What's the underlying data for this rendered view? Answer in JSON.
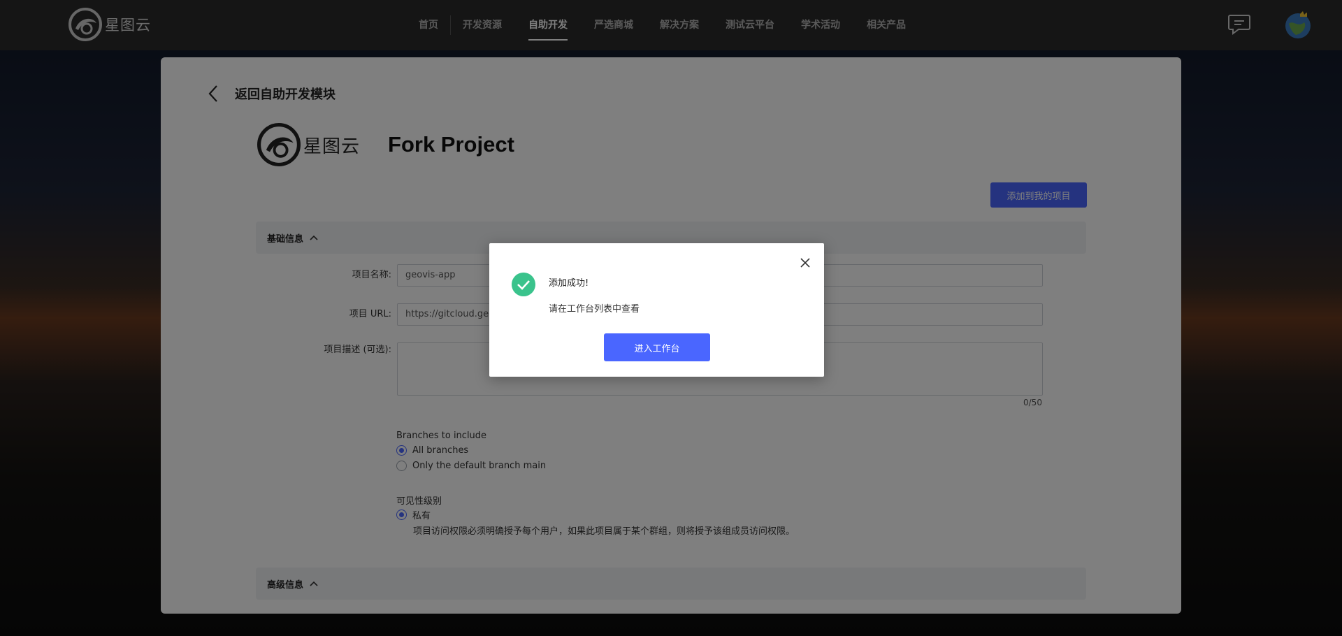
{
  "header": {
    "logo_text": "星图云",
    "nav": [
      {
        "label": "首页"
      },
      {
        "label": "开发资源"
      },
      {
        "label": "自助开发"
      },
      {
        "label": "严选商城"
      },
      {
        "label": "解决方案"
      },
      {
        "label": "测试云平台"
      },
      {
        "label": "学术活动"
      },
      {
        "label": "相关产品"
      }
    ],
    "active_nav": "自助开发",
    "icons": [
      "chat-icon",
      "avatar"
    ]
  },
  "page": {
    "back_label": "返回自助开发模块",
    "brand_text": "星图云",
    "title": "Fork Project",
    "add_button": "添加到我的项目",
    "basic_section": "基础信息",
    "advanced_section": "高级信息",
    "form": {
      "name_label": "项目名称:",
      "name_value": "geovis-app",
      "url_label": "项目 URL:",
      "url_value": "https://gitcloud.geo",
      "desc_label": "项目描述 (可选):",
      "desc_counter": "0/50"
    },
    "branches": {
      "title": "Branches to include",
      "options": [
        "All branches",
        "Only the default branch main"
      ],
      "selected": "All branches"
    },
    "visibility": {
      "title": "可见性级别",
      "option": "私有",
      "note": "项目访问权限必须明确授予每个用户，如果此项目属于某个群组，则将授予该组成员访问权限。"
    }
  },
  "modal": {
    "title": "添加成功!",
    "desc": "请在工作台列表中查看",
    "button": "进入工作台"
  },
  "colors": {
    "primary": "#4a66ff",
    "success": "#3ac38c",
    "topbar": "#2b2b2b"
  }
}
